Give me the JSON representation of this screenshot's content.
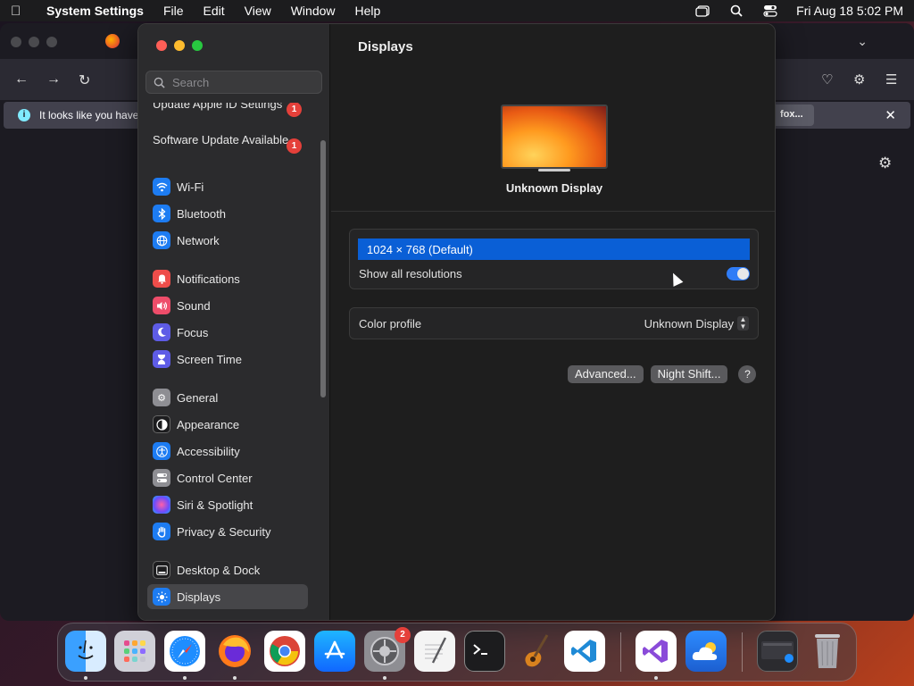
{
  "menubar": {
    "app_name": "System Settings",
    "items": [
      "File",
      "Edit",
      "View",
      "Window",
      "Help"
    ],
    "datetime": "Fri Aug 18  5:02 PM"
  },
  "firefox": {
    "notice_text": "It looks like you have",
    "notice_button": "fox..."
  },
  "sidebar": {
    "search_placeholder": "Search",
    "updates": [
      {
        "label": "Update Apple ID Settings",
        "badge": "1"
      },
      {
        "label": "Software Update Available",
        "badge": "1"
      }
    ],
    "items": [
      {
        "label": "Wi-Fi",
        "icon": "wifi-icon",
        "color": "#1d7cf2"
      },
      {
        "label": "Bluetooth",
        "icon": "bluetooth-icon",
        "color": "#1d7cf2"
      },
      {
        "label": "Network",
        "icon": "globe-icon",
        "color": "#1d7cf2"
      },
      {
        "label": "Notifications",
        "icon": "bell-icon",
        "color": "#ee4d4a"
      },
      {
        "label": "Sound",
        "icon": "speaker-icon",
        "color": "#ee4d6a"
      },
      {
        "label": "Focus",
        "icon": "moon-icon",
        "color": "#5e5ce6"
      },
      {
        "label": "Screen Time",
        "icon": "hourglass-icon",
        "color": "#5e5ce6"
      },
      {
        "label": "General",
        "icon": "gear-icon",
        "color": "#8e8e93"
      },
      {
        "label": "Appearance",
        "icon": "appearance-icon",
        "color": "#1c1c1e"
      },
      {
        "label": "Accessibility",
        "icon": "accessibility-icon",
        "color": "#1d7cf2"
      },
      {
        "label": "Control Center",
        "icon": "control-center-icon",
        "color": "#8e8e93"
      },
      {
        "label": "Siri & Spotlight",
        "icon": "siri-icon",
        "color": "#b44ce0"
      },
      {
        "label": "Privacy & Security",
        "icon": "hand-icon",
        "color": "#1d7cf2"
      },
      {
        "label": "Desktop & Dock",
        "icon": "dock-icon",
        "color": "#1c1c1e"
      },
      {
        "label": "Displays",
        "icon": "sun-icon",
        "color": "#1d7cf2"
      }
    ]
  },
  "content": {
    "title": "Displays",
    "display_name": "Unknown Display",
    "resolution": "1024 × 768 (Default)",
    "show_all_label": "Show all resolutions",
    "show_all_on": true,
    "color_profile_label": "Color profile",
    "color_profile_value": "Unknown Display",
    "advanced_button": "Advanced...",
    "night_shift_button": "Night Shift...",
    "help_button": "?"
  },
  "dock": {
    "settings_badge": "2"
  }
}
